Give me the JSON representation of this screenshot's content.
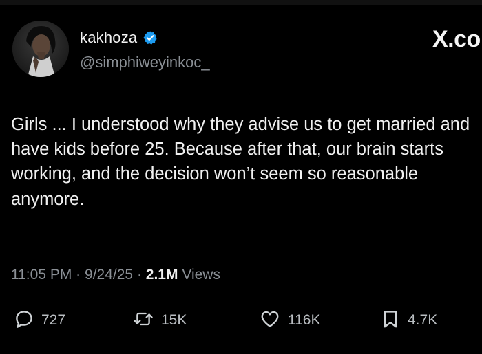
{
  "user": {
    "display_name": "kakhoza",
    "handle": "@simphiweyinkoc_",
    "verified_color": "#1d9bf0"
  },
  "brand": {
    "logo_text": "X.co"
  },
  "tweet": {
    "text": "Girls ... I understood why they advise us to get married and have kids before 25. Because after that, our brain starts working, and the decision won’t seem so reasonable anymore.",
    "time": "11:05 PM",
    "date": "9/24/25",
    "separator": "·",
    "views_count": "2.1M",
    "views_label": "Views"
  },
  "actions": {
    "replies": "727",
    "reposts": "15K",
    "likes": "116K",
    "bookmarks": "4.7K"
  },
  "icons": {
    "reply": "reply-icon",
    "repost": "repost-icon",
    "like": "heart-icon",
    "bookmark": "bookmark-icon",
    "verified": "verified-badge-icon"
  }
}
